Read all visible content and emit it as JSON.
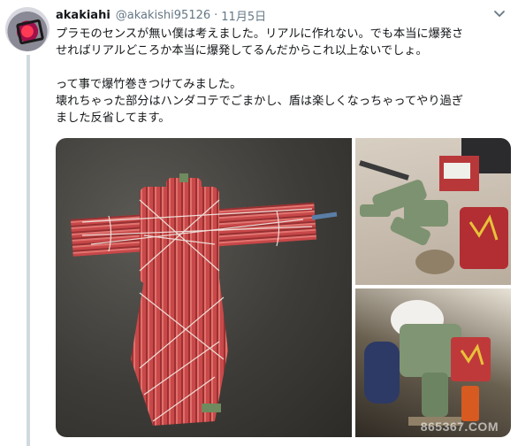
{
  "tweet": {
    "display_name": "akakiahi",
    "handle": "@akakishi95126",
    "separator": "·",
    "date": "11月5日",
    "text_lines": [
      "プラモのセンスが無い僕は考えました。リアルに作れない。でも本当に爆発さ",
      "せればリアルどころか本当に爆発してるんだからこれ以上ないでしょ。",
      "",
      "って事で爆竹巻きつけてみました。",
      "壊れちゃった部分はハンダコテでごまかし、盾は楽しくなっちゃってやり過ぎ",
      "ました反省してます。"
    ]
  },
  "watermark": "865367.COM",
  "colors": {
    "name": "#14171a",
    "secondary": "#657786",
    "thread_line": "#cfd9de"
  }
}
